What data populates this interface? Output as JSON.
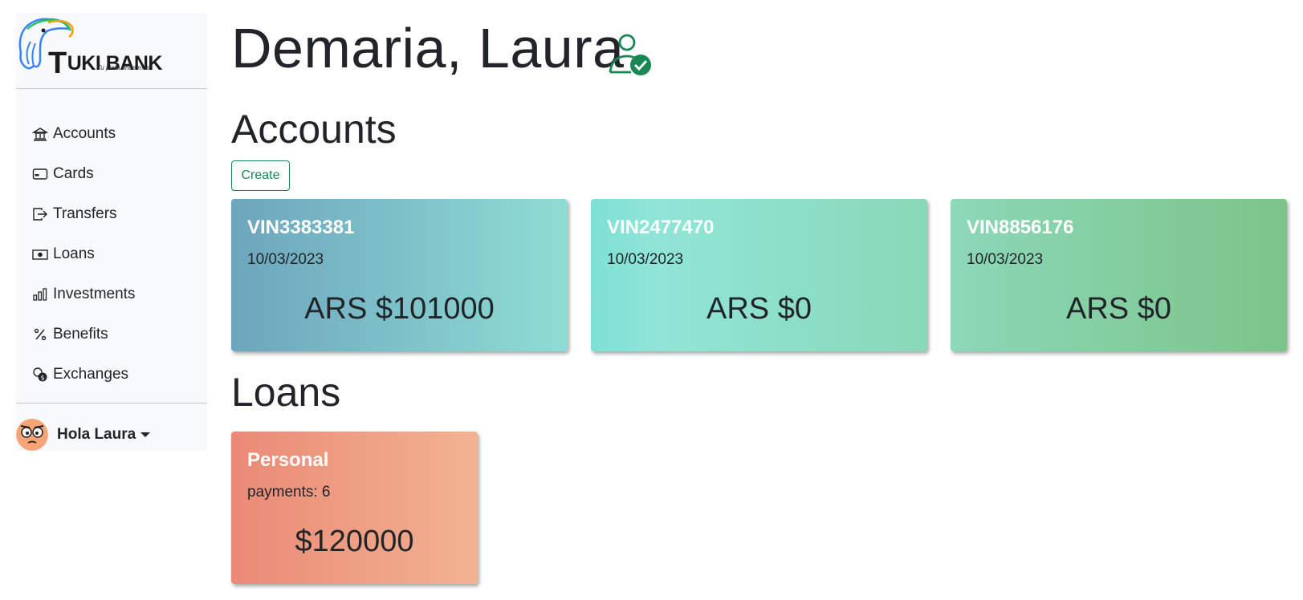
{
  "brand": {
    "name_big": "T",
    "name_rest": "UKI BANK",
    "tagline": "Tu plata rinde más"
  },
  "sidebar": {
    "items": [
      {
        "label": "Accounts",
        "icon": "bank-icon"
      },
      {
        "label": "Cards",
        "icon": "credit-card-icon"
      },
      {
        "label": "Transfers",
        "icon": "box-arrow-right-icon"
      },
      {
        "label": "Loans",
        "icon": "cash-icon"
      },
      {
        "label": "Investments",
        "icon": "bar-chart-icon"
      },
      {
        "label": "Benefits",
        "icon": "percent-icon"
      },
      {
        "label": "Exchanges",
        "icon": "coin-exchange-icon"
      }
    ],
    "user_greeting": "Hola Laura"
  },
  "main": {
    "client_name": "Demaria, Laura",
    "accounts_title": "Accounts",
    "create_label": "Create",
    "accounts": [
      {
        "number": "VIN3383381",
        "date": "10/03/2023",
        "balance": "ARS $101000"
      },
      {
        "number": "VIN2477470",
        "date": "10/03/2023",
        "balance": "ARS $0"
      },
      {
        "number": "VIN8856176",
        "date": "10/03/2023",
        "balance": "ARS $0"
      }
    ],
    "loans_title": "Loans",
    "loans": [
      {
        "name": "Personal",
        "payments": "payments: 6",
        "amount": "$120000"
      }
    ]
  },
  "colors": {
    "accent_green": "#198754",
    "sidebar_bg": "#f8f9fa"
  }
}
